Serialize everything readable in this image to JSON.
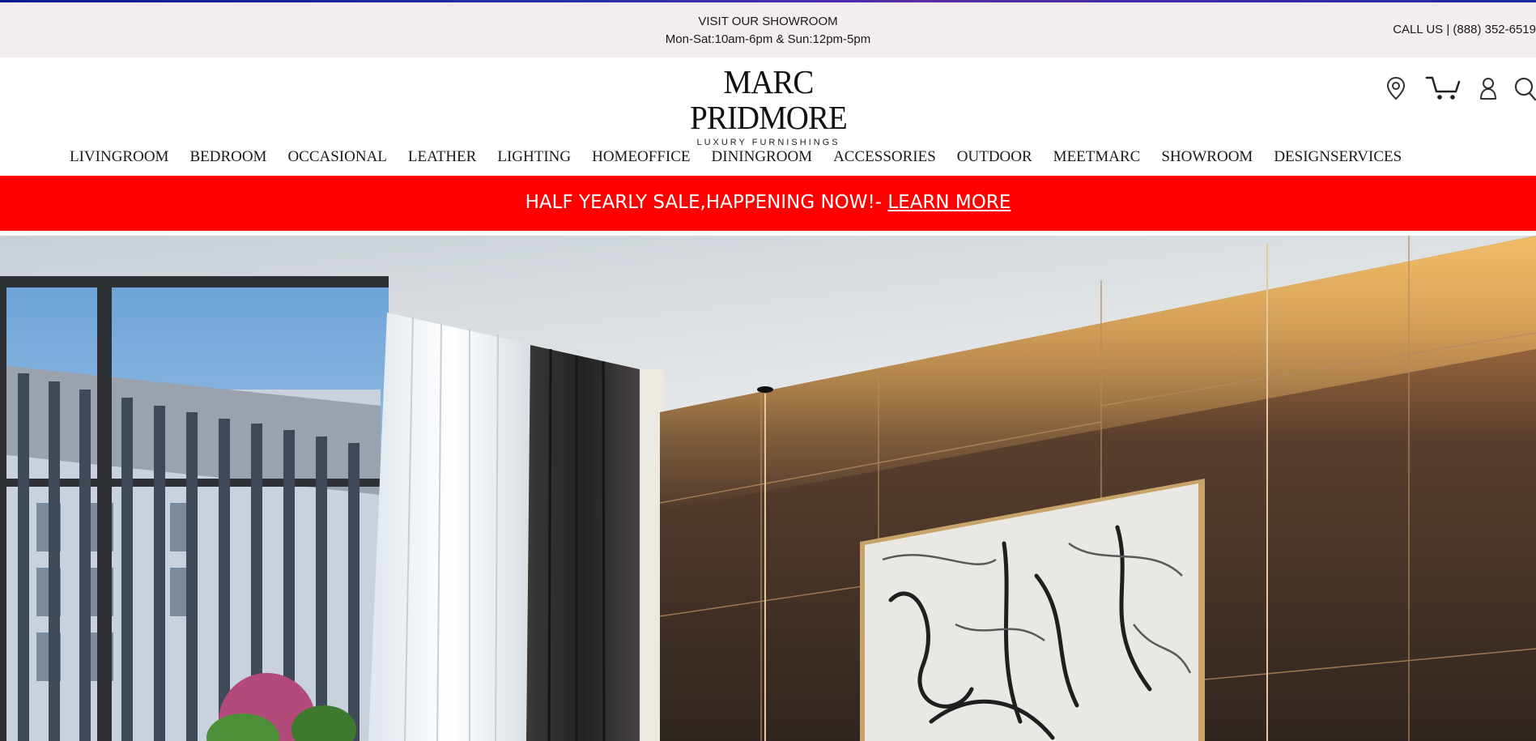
{
  "topbar": {
    "visit_label": "VISIT OUR SHOWROOM",
    "hours": "Mon-Sat:10am-6pm & Sun:12pm-5pm",
    "call_us": "CALL US | (888) 352-6519"
  },
  "logo": {
    "name": "MARC PRIDMORE",
    "tagline": "LUXURY FURNISHINGS"
  },
  "header_icons": [
    "location-pin-icon",
    "cart-icon",
    "account-icon",
    "search-icon"
  ],
  "nav": {
    "items": [
      {
        "label": "LIVINGROOM"
      },
      {
        "label": "BEDROOM"
      },
      {
        "label": "OCCASIONAL"
      },
      {
        "label": "LEATHER"
      },
      {
        "label": "LIGHTING"
      },
      {
        "label": "HOMEOFFICE"
      },
      {
        "label": "DININGROOM"
      },
      {
        "label": "ACCESSORIES"
      },
      {
        "label": "OUTDOOR"
      },
      {
        "label": "MEETMARC"
      },
      {
        "label": "SHOWROOM"
      },
      {
        "label": "DESIGNSERVICES"
      }
    ]
  },
  "sale_banner": {
    "text": "HALF YEARLY SALE,HAPPENING NOW!- ",
    "link": "LEARN MORE"
  },
  "colors": {
    "topbar_bg": "#f3eded",
    "sale_bg": "#ff0000",
    "text": "#1a1a1a"
  }
}
